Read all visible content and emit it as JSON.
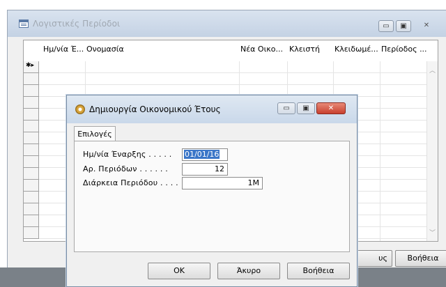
{
  "outer_window": {
    "title": "Λογιστικές Περίοδοι",
    "columns": [
      "Ημ/νία Έ...",
      "Ονομασία",
      "Νέα Οικο...",
      "Κλειστή",
      "Κλειδωμέ...",
      "Περίοδος ..."
    ],
    "new_row_marker": "✱▸",
    "buttons": {
      "partial_label": "υς",
      "help_label": "Βοήθεια"
    }
  },
  "dialog": {
    "title": "Δημιουργία Οικονομικού Έτους",
    "tab_label": "Επιλογές",
    "fields": {
      "start_date_label": "Ημ/νία Έναρξης . . . . .",
      "start_date_value": "01/01/16",
      "periods_label": "Αρ. Περιόδων . . . . . .",
      "periods_value": "12",
      "duration_label": "Διάρκεια Περιόδου . . . .",
      "duration_value": "1M"
    },
    "buttons": {
      "ok": "OK",
      "cancel": "Άκυρο",
      "help": "Βοήθεια"
    }
  },
  "window_controls": {
    "minimize": "▭",
    "maximize": "▣",
    "close": "✕"
  }
}
